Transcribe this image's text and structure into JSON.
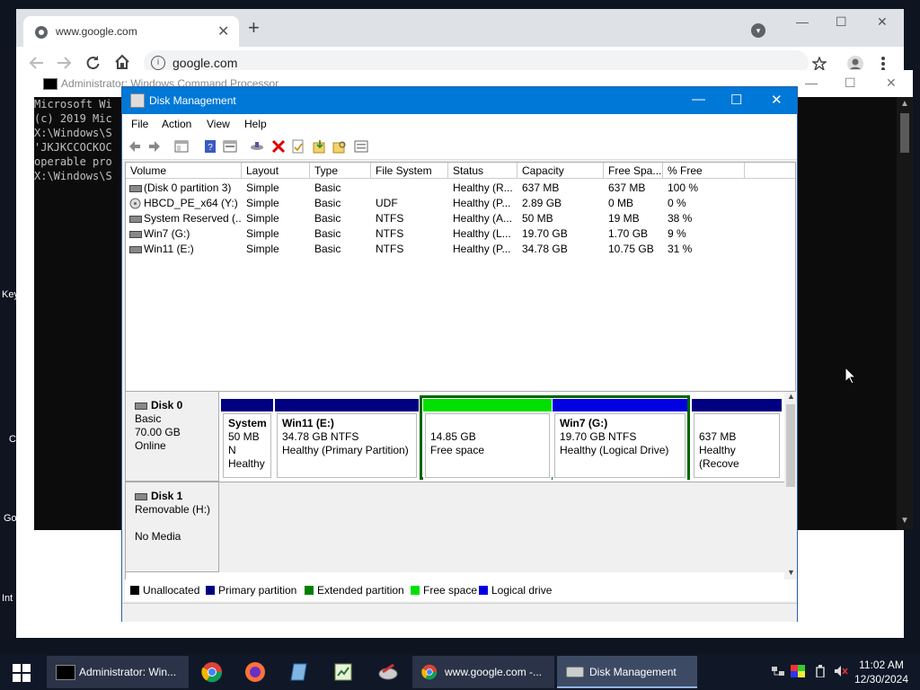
{
  "desktop": {
    "labels": [
      "Key",
      "C",
      "Go",
      "Int"
    ]
  },
  "chrome": {
    "tab_title": "www.google.com",
    "tab_close": "✕",
    "new_tab": "+",
    "url": "google.com",
    "win_min": "—",
    "win_max": "☐",
    "win_close": "✕",
    "profile_menu": "▾"
  },
  "cmd": {
    "title": "Administrator: Windows Command Processor",
    "lines": [
      "Microsoft Wi",
      "(c) 2019 Mic",
      "",
      "X:\\Windows\\S",
      "'JKJKCCOCKOC",
      "operable pro",
      "",
      "X:\\Windows\\S"
    ],
    "win_min": "—",
    "win_max": "☐",
    "win_close": "✕"
  },
  "dm": {
    "title": "Disk Management",
    "win_min": "—",
    "win_max": "☐",
    "win_close": "✕",
    "menu": [
      "File",
      "Action",
      "View",
      "Help"
    ],
    "columns": [
      "Volume",
      "Layout",
      "Type",
      "File System",
      "Status",
      "Capacity",
      "Free Spa...",
      "% Free"
    ],
    "volumes": [
      {
        "volume": "(Disk 0 partition 3)",
        "layout": "Simple",
        "type": "Basic",
        "fs": "",
        "status": "Healthy (R...",
        "capacity": "637 MB",
        "free": "637 MB",
        "pct": "100 %"
      },
      {
        "volume": "HBCD_PE_x64 (Y:)",
        "layout": "Simple",
        "type": "Basic",
        "fs": "UDF",
        "status": "Healthy (P...",
        "capacity": "2.89 GB",
        "free": "0 MB",
        "pct": "0 %"
      },
      {
        "volume": "System Reserved (...",
        "layout": "Simple",
        "type": "Basic",
        "fs": "NTFS",
        "status": "Healthy (A...",
        "capacity": "50 MB",
        "free": "19 MB",
        "pct": "38 %"
      },
      {
        "volume": "Win7 (G:)",
        "layout": "Simple",
        "type": "Basic",
        "fs": "NTFS",
        "status": "Healthy (L...",
        "capacity": "19.70 GB",
        "free": "1.70 GB",
        "pct": "9 %"
      },
      {
        "volume": "Win11 (E:)",
        "layout": "Simple",
        "type": "Basic",
        "fs": "NTFS",
        "status": "Healthy (P...",
        "capacity": "34.78 GB",
        "free": "10.75 GB",
        "pct": "31 %"
      }
    ],
    "disk0": {
      "name": "Disk 0",
      "type": "Basic",
      "size": "70.00 GB",
      "state": "Online",
      "partitions": {
        "system": {
          "title": "System",
          "l1": "50 MB N",
          "l2": "Healthy"
        },
        "win11": {
          "title": "Win11  (E:)",
          "l1": "34.78 GB NTFS",
          "l2": "Healthy (Primary Partition)"
        },
        "free": {
          "l1": "14.85 GB",
          "l2": "Free space"
        },
        "win7": {
          "title": "Win7  (G:)",
          "l1": "19.70 GB NTFS",
          "l2": "Healthy (Logical Drive)"
        },
        "recovery": {
          "l1": "637 MB",
          "l2": "Healthy (Recove"
        }
      }
    },
    "disk1": {
      "name": "Disk 1",
      "type": "Removable (H:)",
      "state": "No Media"
    },
    "legend": [
      {
        "label": "Unallocated",
        "color": "#000000"
      },
      {
        "label": "Primary partition",
        "color": "#000080"
      },
      {
        "label": "Extended partition",
        "color": "#008000"
      },
      {
        "label": "Free space",
        "color": "#00e000"
      },
      {
        "label": "Logical drive",
        "color": "#0000e0"
      }
    ]
  },
  "taskbar": {
    "tasks": [
      {
        "label": "Administrator: Win..."
      },
      {
        "label": "www.google.com -..."
      },
      {
        "label": "Disk Management"
      }
    ],
    "time": "11:02 AM",
    "date": "12/30/2024"
  }
}
